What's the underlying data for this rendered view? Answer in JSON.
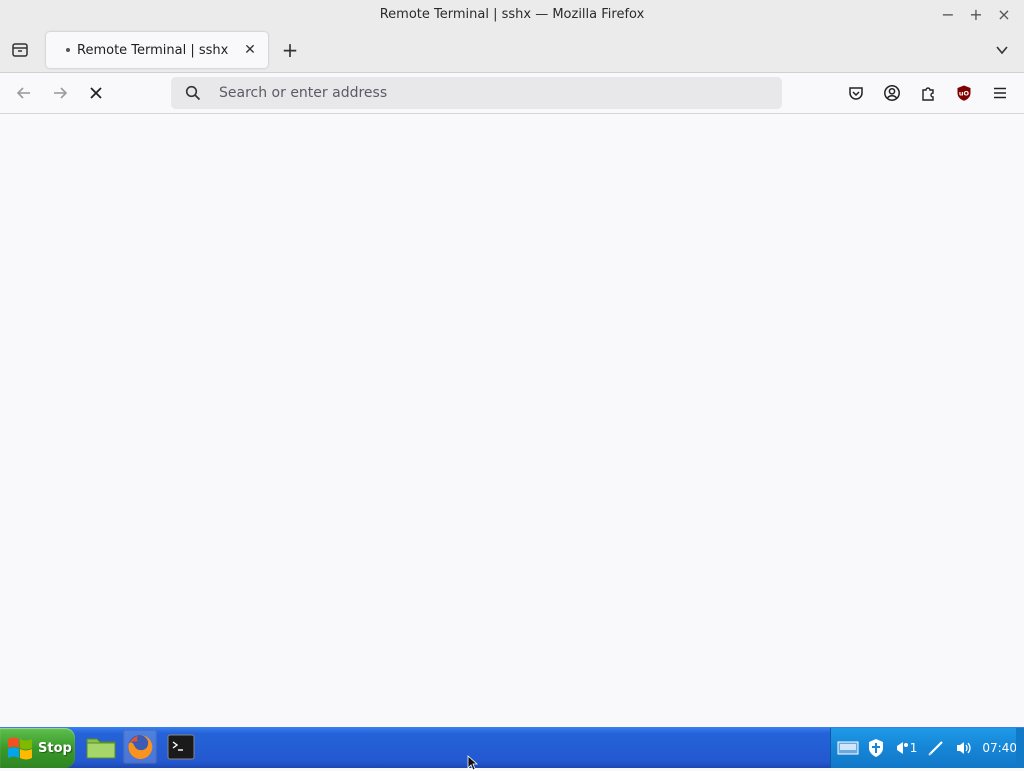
{
  "window": {
    "title": "Remote Terminal | sshx — Mozilla Firefox",
    "controls": {
      "minimize": "−",
      "maximize": "+",
      "close": "×"
    }
  },
  "tabs": [
    {
      "label": "Remote Terminal | sshx",
      "loading": true
    }
  ],
  "tabstrip": {
    "new_tab_label": "+"
  },
  "navbar": {
    "back_enabled": false,
    "forward_enabled": false,
    "stop_loading": true
  },
  "urlbar": {
    "placeholder": "Search or enter address",
    "value": ""
  },
  "toolbar_icons": [
    "pocket-icon",
    "account-icon",
    "extensions-icon",
    "ublock-icon",
    "menu-icon"
  ],
  "taskbar": {
    "start_label": "Stop",
    "apps": [
      "file-manager-icon",
      "firefox-icon",
      "terminal-icon"
    ],
    "tray": {
      "notification_count": "1",
      "clock": "07:40"
    }
  },
  "colors": {
    "taskbar_blue": "#2358d0",
    "start_green": "#3a9a2a",
    "tray_blue": "#1685d6",
    "ublock_red": "#800000"
  }
}
